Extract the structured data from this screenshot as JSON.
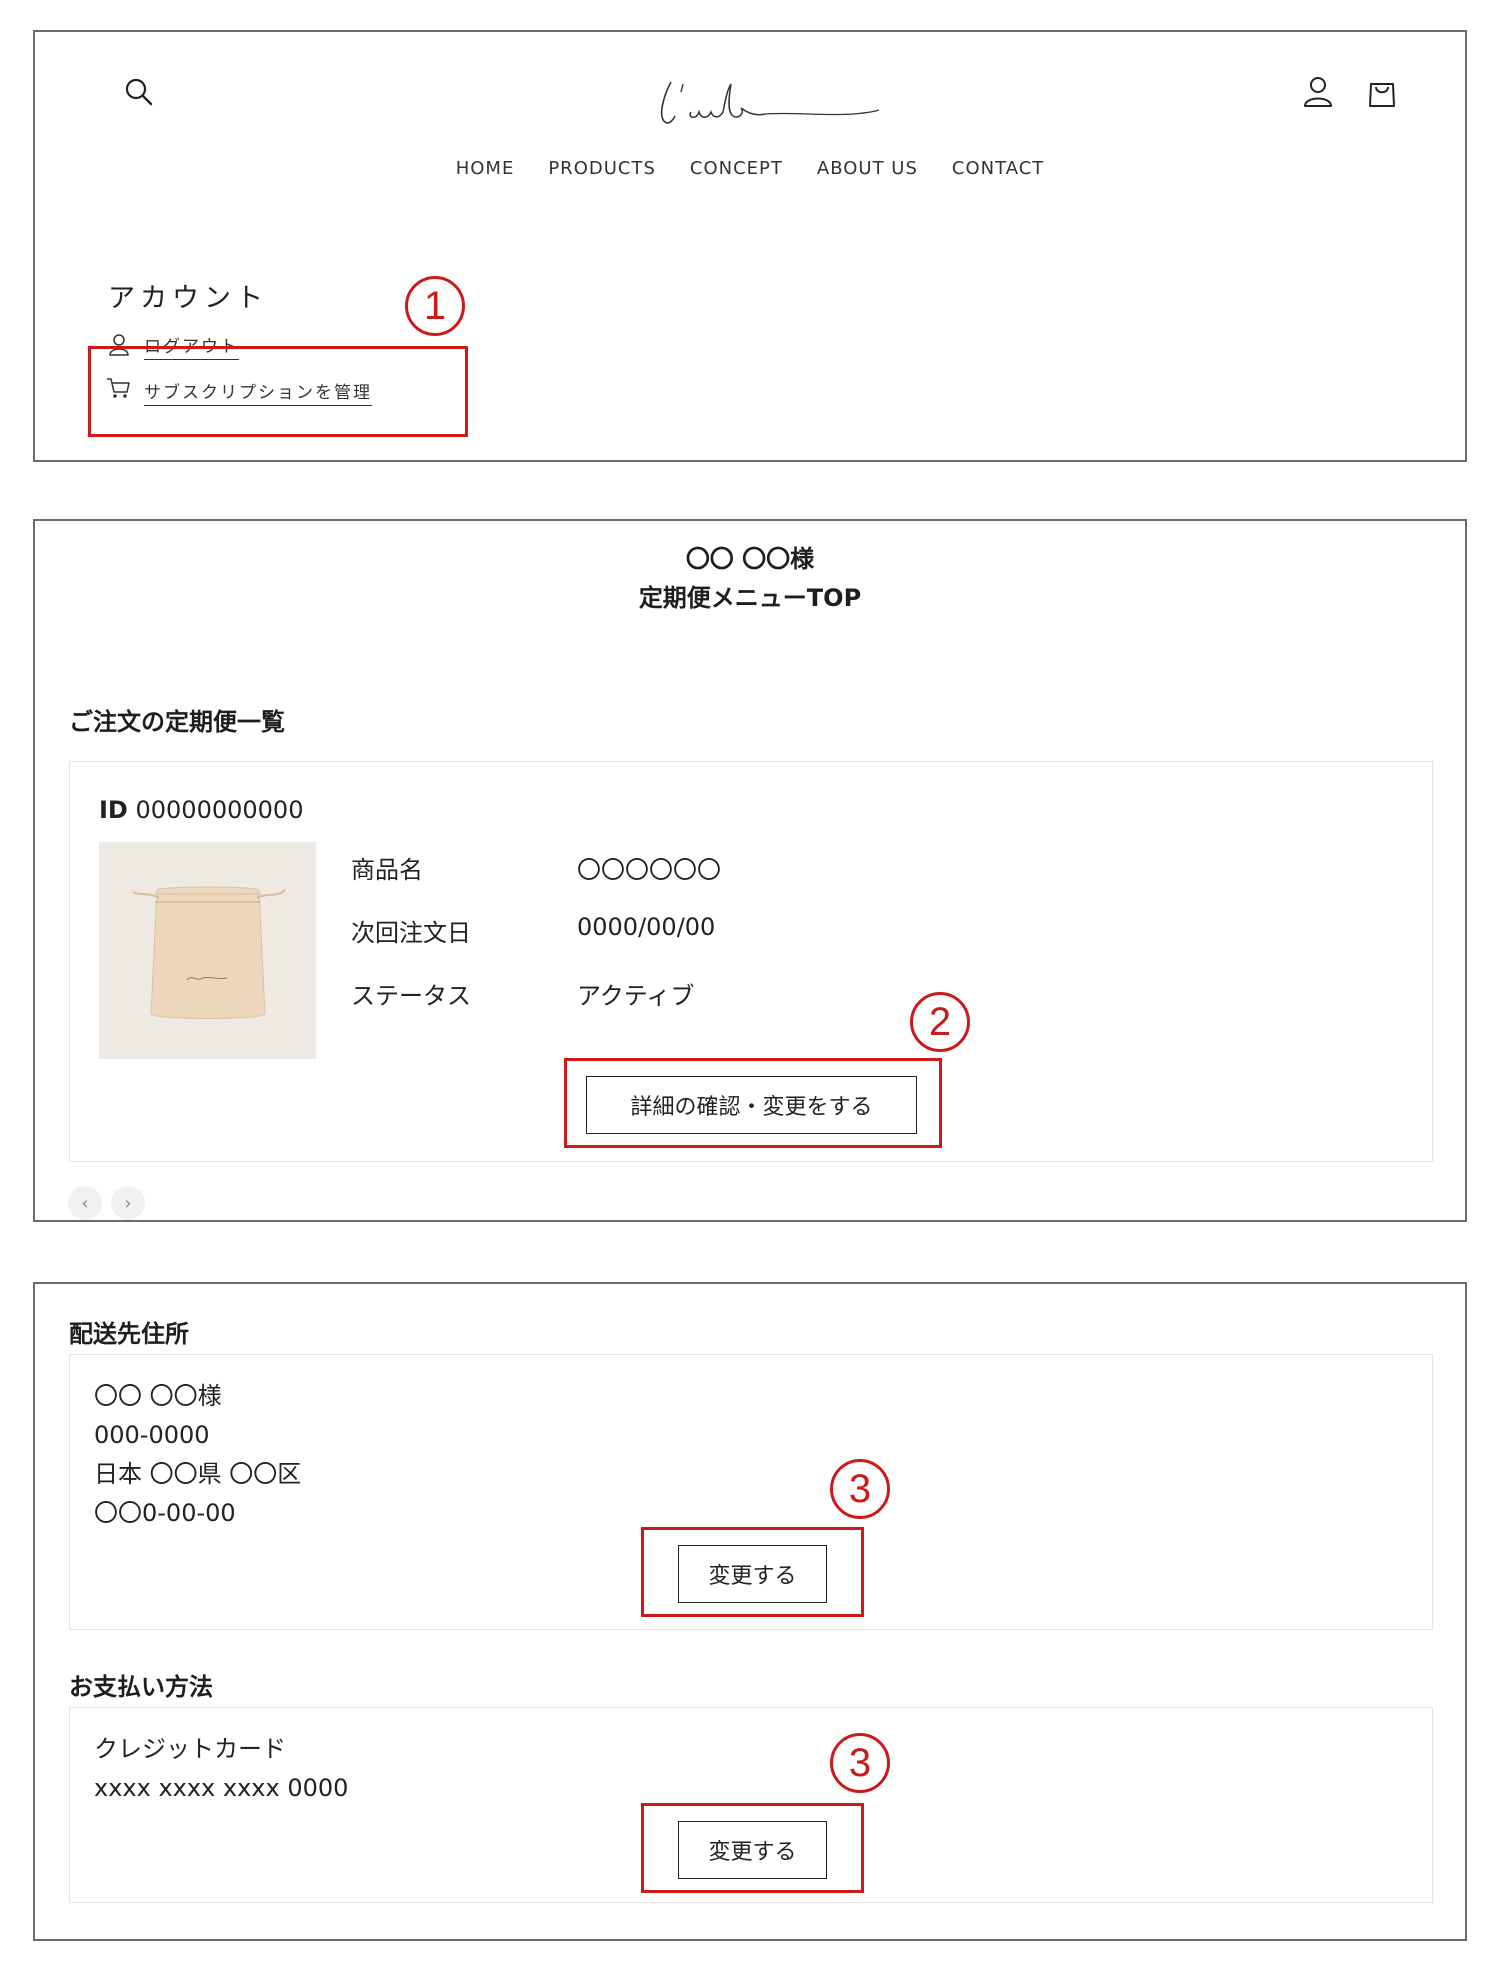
{
  "header": {
    "logo_text": "l'aube",
    "nav": [
      "HOME",
      "PRODUCTS",
      "CONCEPT",
      "ABOUT US",
      "CONTACT"
    ]
  },
  "account": {
    "title": "アカウント",
    "logout_label": "ログアウト",
    "subscription_label": "サブスクリプションを管理"
  },
  "annotations": {
    "one": "1",
    "two": "2",
    "three": "3"
  },
  "subscription": {
    "customer_name": "〇〇 〇〇様",
    "menu_title": "定期便メニューTOP",
    "list_heading": "ご注文の定期便一覧",
    "order_id_label": "ID",
    "order_id": "00000000000",
    "fields": [
      {
        "label": "商品名",
        "value": "〇〇〇〇〇〇"
      },
      {
        "label": "次回注文日",
        "value": "0000/00/00"
      },
      {
        "label": "ステータス",
        "value": "アクティブ"
      }
    ],
    "detail_button": "詳細の確認・変更をする",
    "prev_icon": "‹",
    "next_icon": "›"
  },
  "shipping": {
    "heading": "配送先住所",
    "lines": [
      "〇〇 〇〇様",
      "000-0000",
      "日本 〇〇県 〇〇区",
      "〇〇0-00-00"
    ],
    "change_button": "変更する"
  },
  "payment": {
    "heading": "お支払い方法",
    "lines": [
      "クレジットカード",
      "xxxx xxxx xxxx 0000"
    ],
    "change_button": "変更する"
  },
  "colors": {
    "annotation_red": "#cc1a1a",
    "border": "#6b6b6b",
    "text": "#222222"
  }
}
